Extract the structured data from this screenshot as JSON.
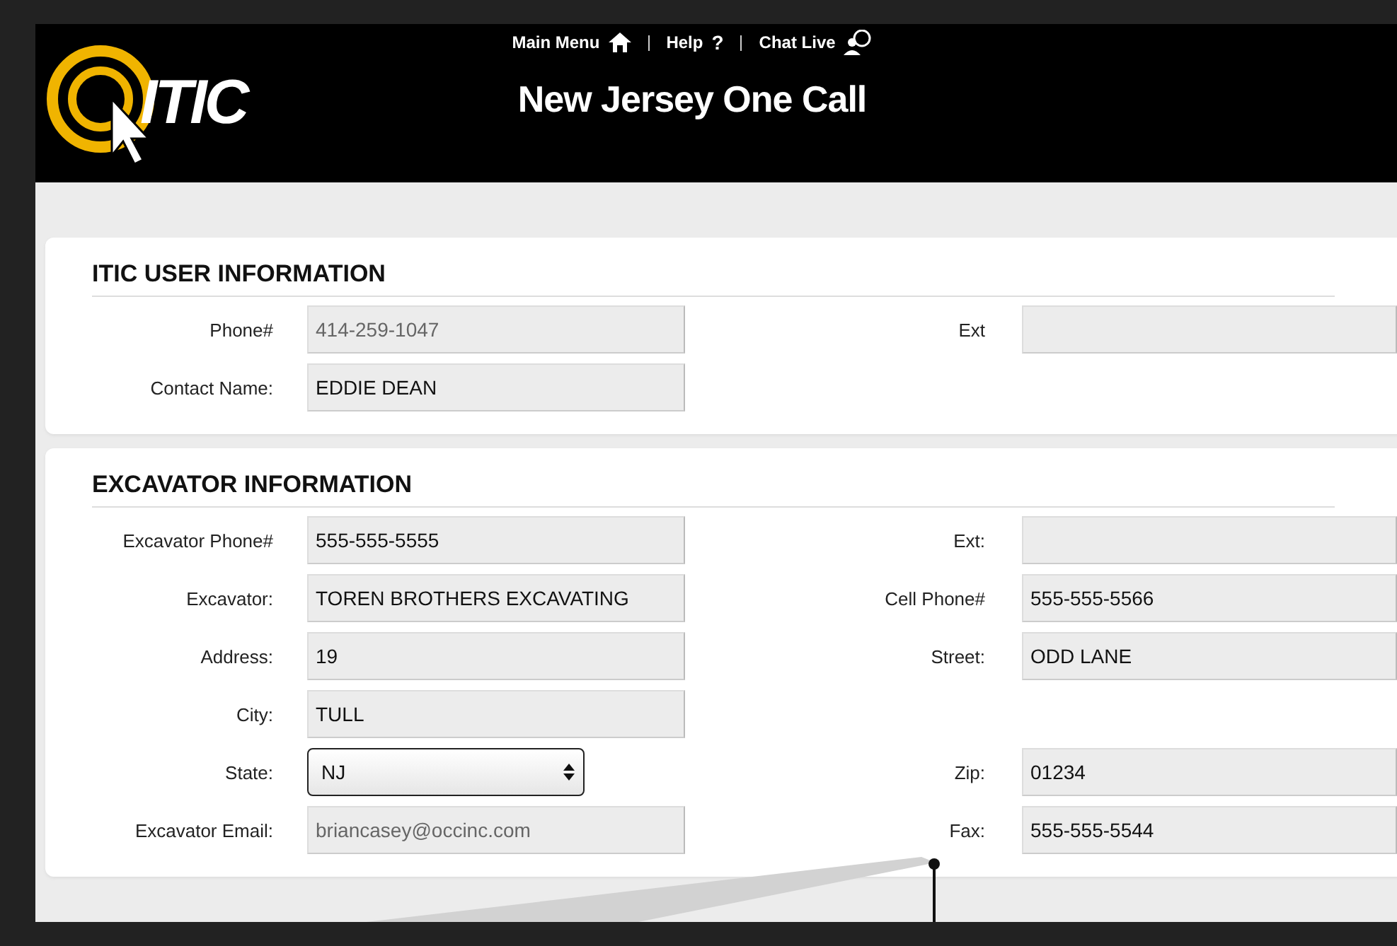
{
  "header": {
    "logo_text": "ITIC",
    "title": "New Jersey One Call",
    "nav": [
      {
        "label": "Main Menu"
      },
      {
        "label": "Help",
        "glyph": "?"
      },
      {
        "label": "Chat Live"
      }
    ]
  },
  "sections": [
    {
      "title": "ITIC USER INFORMATION",
      "rows": [
        [
          {
            "label": "Phone#",
            "placeholder": "414-259-1047",
            "kind": "text"
          },
          {
            "label": "Ext",
            "kind": "text"
          }
        ],
        [
          {
            "label": "Contact Name:",
            "value": "EDDIE DEAN",
            "kind": "text"
          },
          null
        ]
      ]
    },
    {
      "title": "EXCAVATOR INFORMATION",
      "rows": [
        [
          {
            "label": "Excavator Phone#",
            "value": "555-555-5555",
            "kind": "text"
          },
          {
            "label": "Ext:",
            "kind": "text"
          }
        ],
        [
          {
            "label": "Excavator:",
            "value": "TOREN BROTHERS EXCAVATING",
            "kind": "text"
          },
          {
            "label": "Cell Phone#",
            "value": "555-555-5566",
            "kind": "text"
          }
        ],
        [
          {
            "label": "Address:",
            "value": "19",
            "kind": "text"
          },
          {
            "label": "Street:",
            "value": "ODD LANE",
            "kind": "text"
          }
        ],
        [
          {
            "label": "City:",
            "value": "TULL",
            "kind": "text"
          },
          null
        ],
        [
          {
            "label": "State:",
            "value": "NJ",
            "kind": "select"
          },
          {
            "label": "Zip:",
            "value": "01234",
            "kind": "text"
          }
        ],
        [
          {
            "label": "Excavator Email:",
            "placeholder": "briancasey@occinc.com",
            "kind": "text"
          },
          {
            "label": "Fax:",
            "value": "555-555-5544",
            "kind": "text"
          }
        ]
      ]
    }
  ]
}
